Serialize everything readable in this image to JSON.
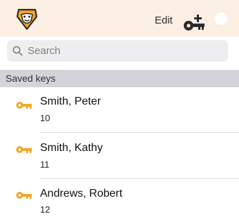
{
  "header": {
    "logo_icon": "lion-logo-icon",
    "edit_label": "Edit",
    "add_key_icon": "add-key-icon",
    "toggle_icon": "circle-toggle-icon",
    "background": "#fcefe4",
    "accent": "#f5a623"
  },
  "search": {
    "placeholder": "Search",
    "icon": "search-icon"
  },
  "section": {
    "title": "Saved keys"
  },
  "keys": [
    {
      "name": "Smith, Peter",
      "number": "10",
      "icon": "key-icon"
    },
    {
      "name": "Smith, Kathy",
      "number": "11",
      "icon": "key-icon"
    },
    {
      "name": "Andrews, Robert",
      "number": "12",
      "icon": "key-icon"
    }
  ]
}
